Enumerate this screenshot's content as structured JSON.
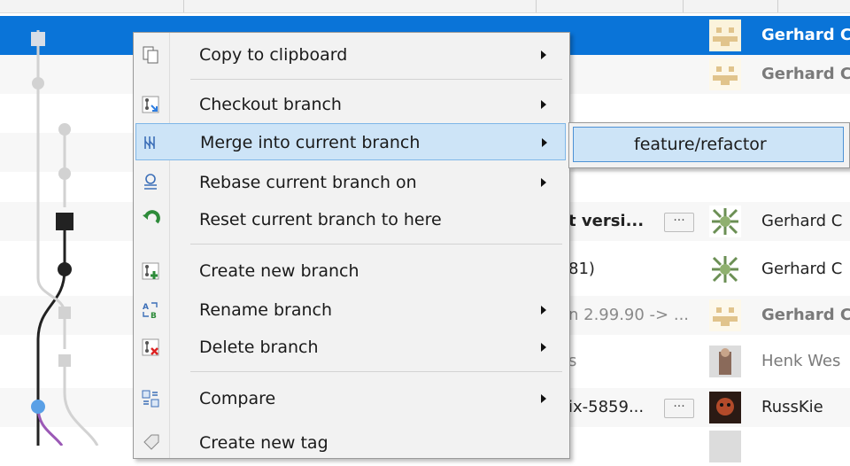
{
  "context_menu": {
    "items": [
      {
        "label": "Copy to clipboard",
        "icon": "copy-icon",
        "has_submenu": true
      },
      {
        "label": "Checkout branch",
        "icon": "checkout-branch-icon",
        "has_submenu": true
      },
      {
        "label": "Merge into current branch",
        "icon": "merge-icon",
        "has_submenu": true
      },
      {
        "label": "Rebase current branch on",
        "icon": "rebase-icon",
        "has_submenu": true
      },
      {
        "label": "Reset current branch to here",
        "icon": "reset-icon",
        "has_submenu": false
      },
      {
        "label": "Create new branch",
        "icon": "create-branch-icon",
        "has_submenu": false
      },
      {
        "label": "Rename branch",
        "icon": "rename-branch-icon",
        "has_submenu": true
      },
      {
        "label": "Delete branch",
        "icon": "delete-branch-icon",
        "has_submenu": true
      },
      {
        "label": "Compare",
        "icon": "compare-icon",
        "has_submenu": true
      },
      {
        "label": "Create new tag",
        "icon": "tag-icon",
        "has_submenu": false
      }
    ],
    "highlighted_item": "Merge into current branch"
  },
  "submenu": {
    "items": [
      {
        "label": "feature/refactor"
      }
    ]
  },
  "commits": [
    {
      "message": "",
      "author": "Gerhard C",
      "selected": true
    },
    {
      "message": "",
      "author": "Gerhard C"
    },
    {
      "message": "",
      "author": ""
    },
    {
      "message": "",
      "author": ""
    },
    {
      "message": "t versi...",
      "author": "Gerhard C",
      "has_more": true
    },
    {
      "message": "81)",
      "author": "Gerhard C"
    },
    {
      "message": "n 2.99.90 -> ...",
      "author": "Gerhard C"
    },
    {
      "message": "s",
      "author": "Henk Wes"
    },
    {
      "message": "ix-5859...",
      "author": "RussKie",
      "has_more": true
    }
  ],
  "more_button_label": "···",
  "colors": {
    "selection": "#0a74d8",
    "menu_highlight": "#cde4f7",
    "menu_highlight_border": "#7fb7e8",
    "graph_dark": "#222222",
    "graph_light": "#cccccc",
    "graph_blue": "#5aa0e6",
    "graph_purple": "#9b59b6"
  }
}
